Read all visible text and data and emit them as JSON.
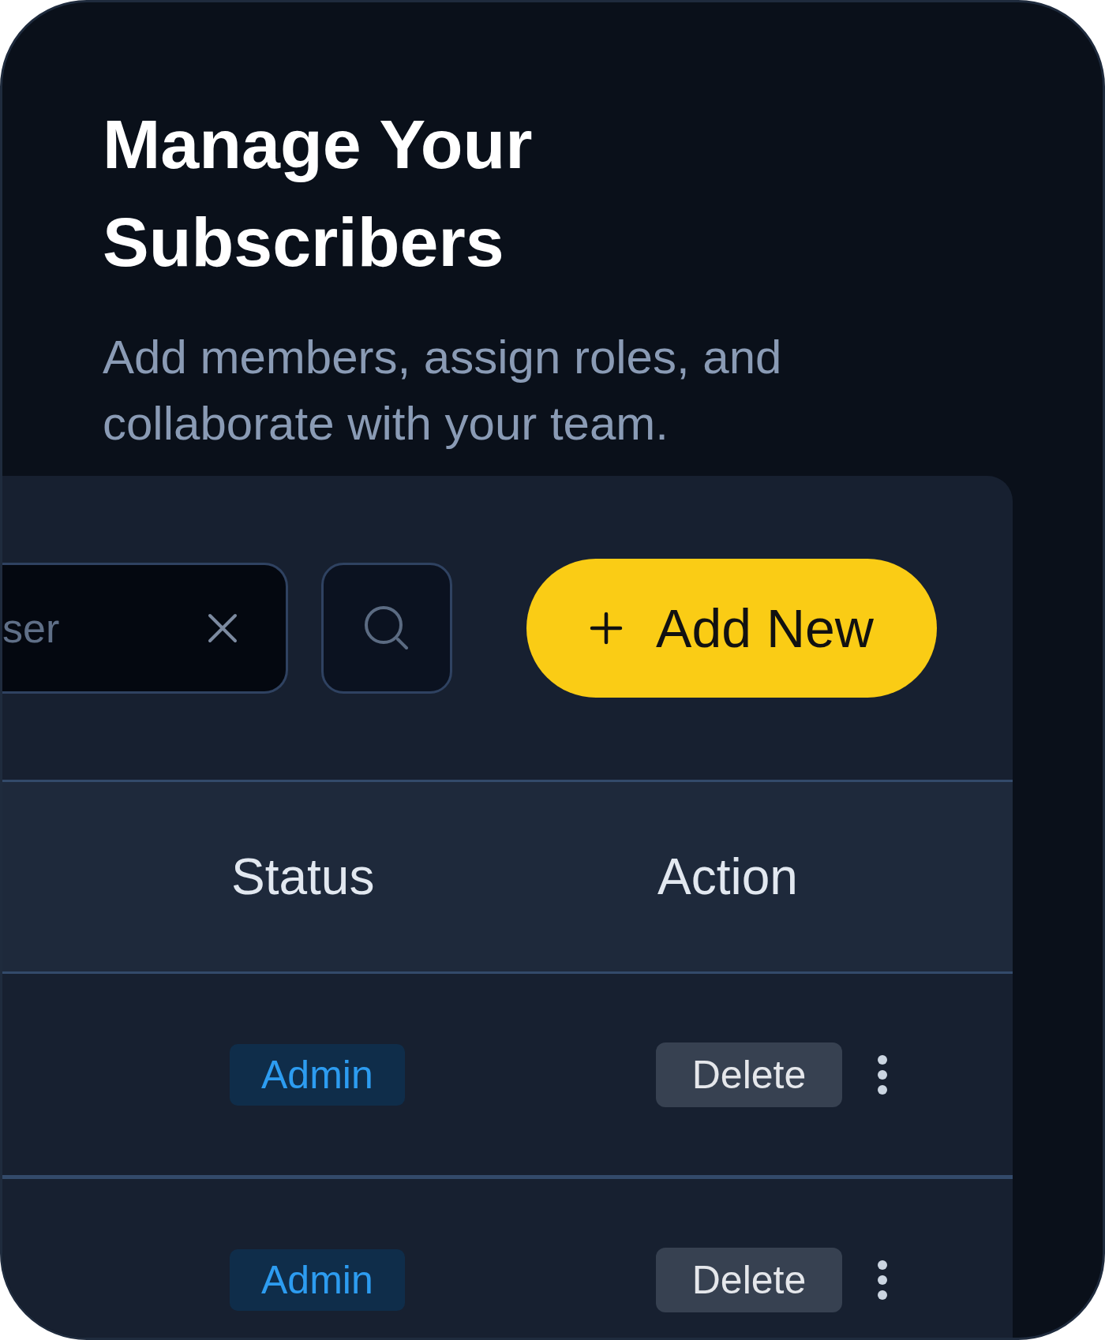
{
  "header": {
    "title": "Manage Your Subscribers",
    "subtitle": "Add members, assign roles, and collaborate with your team."
  },
  "toolbar": {
    "search": {
      "value": "ser"
    },
    "add_button": {
      "label": "Add New"
    }
  },
  "table": {
    "columns": [
      "Status",
      "Action"
    ],
    "rows": [
      {
        "status": "Admin",
        "action": "Delete"
      },
      {
        "status": "Admin",
        "action": "Delete"
      }
    ]
  }
}
